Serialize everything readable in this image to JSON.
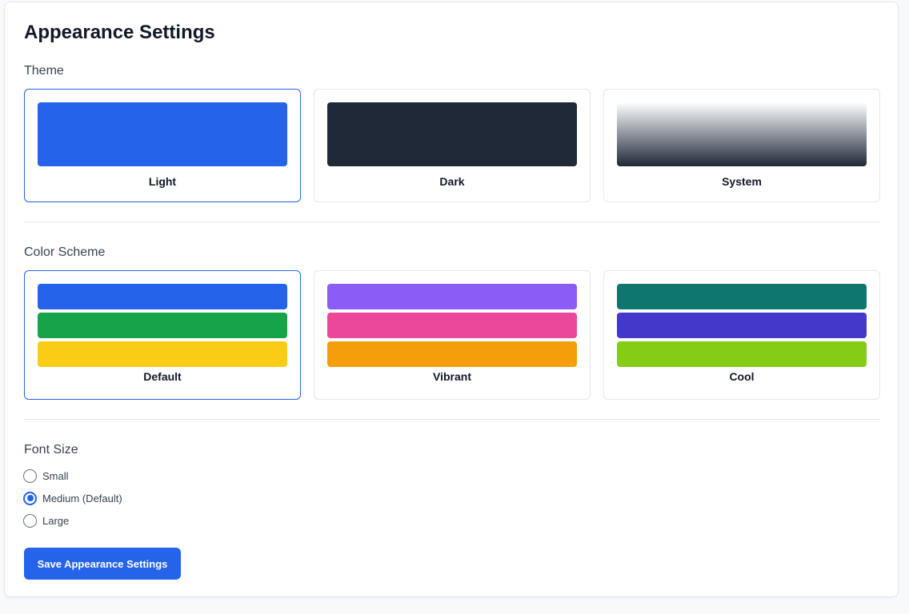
{
  "page": {
    "title": "Appearance Settings"
  },
  "theme": {
    "title": "Theme",
    "options": [
      {
        "label": "Light",
        "selected": true,
        "preview": "#2563eb"
      },
      {
        "label": "Dark",
        "selected": false,
        "preview": "#1f2937"
      },
      {
        "label": "System",
        "selected": false,
        "preview_gradient": [
          "#ffffff",
          "#1f2937"
        ]
      }
    ]
  },
  "color_scheme": {
    "title": "Color Scheme",
    "options": [
      {
        "label": "Default",
        "selected": true,
        "colors": [
          "#2563eb",
          "#16a34a",
          "#facc15"
        ]
      },
      {
        "label": "Vibrant",
        "selected": false,
        "colors": [
          "#8b5cf6",
          "#ec4899",
          "#f59e0b"
        ]
      },
      {
        "label": "Cool",
        "selected": false,
        "colors": [
          "#0f766e",
          "#4338ca",
          "#84cc16"
        ]
      }
    ]
  },
  "font_size": {
    "title": "Font Size",
    "options": [
      {
        "label": "Small",
        "checked": false
      },
      {
        "label": "Medium (Default)",
        "checked": true
      },
      {
        "label": "Large",
        "checked": false
      }
    ]
  },
  "actions": {
    "save_label": "Save Appearance Settings"
  },
  "colors": {
    "accent": "#2563eb",
    "border": "#e5e7eb"
  }
}
